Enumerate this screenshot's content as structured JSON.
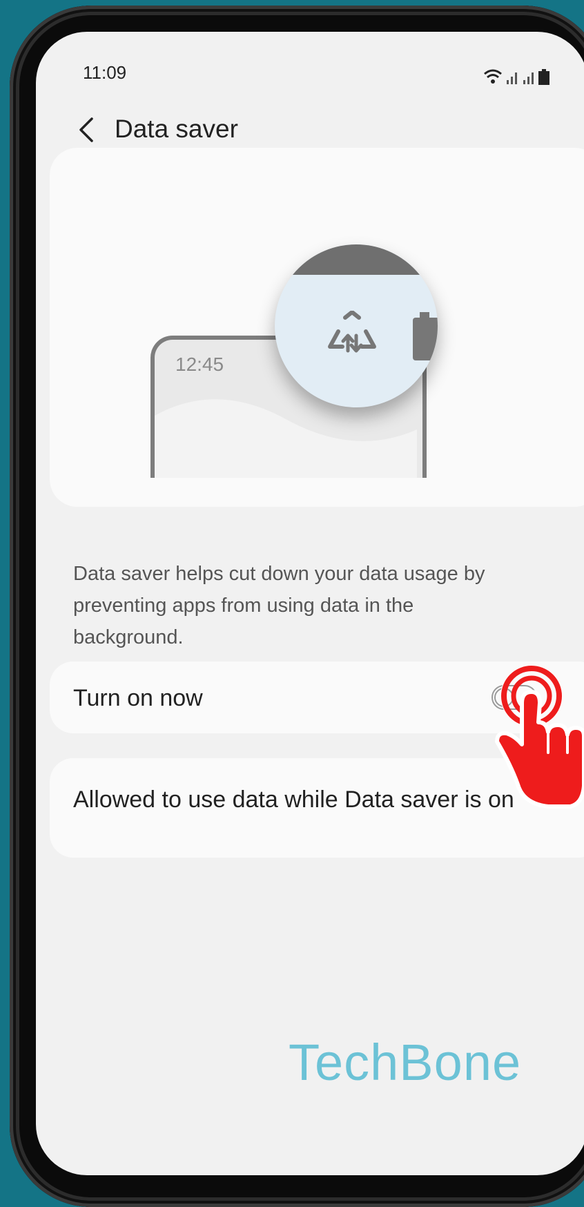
{
  "status_bar": {
    "time": "11:09"
  },
  "header": {
    "title": "Data saver"
  },
  "illustration": {
    "clock": "12:45"
  },
  "description": "Data saver helps cut down your data usage by preventing apps from using data in the background.",
  "settings": [
    {
      "label": "Turn on now",
      "toggle_on": false
    },
    {
      "label": "Allowed to use data while Data saver is on"
    }
  ],
  "watermark": "TechBone",
  "colors": {
    "background": "#147486",
    "screen": "#f1f1f1",
    "card": "#fafafa",
    "tap_hand": "#ee1c1c",
    "watermark": "#6cc2d6"
  },
  "icons": [
    "wifi-icon",
    "signal-icon",
    "battery-icon",
    "back-arrow-icon",
    "data-saver-icon",
    "tap-hand-icon"
  ]
}
